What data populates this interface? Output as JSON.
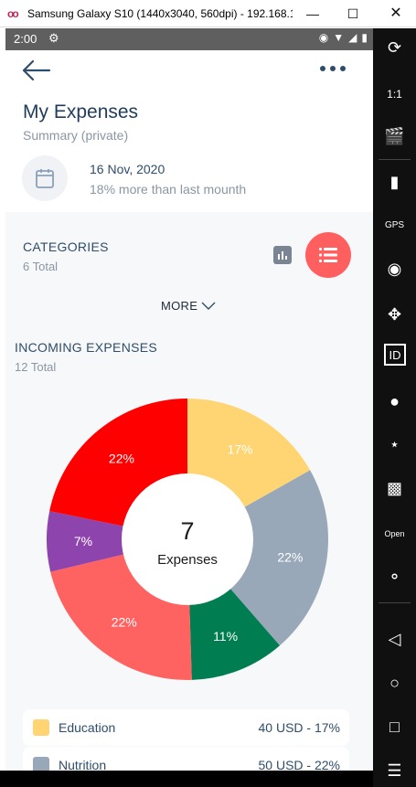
{
  "window": {
    "title": "Samsung Galaxy S10 (1440x3040, 560dpi) - 192.168.1...",
    "logo": "oo"
  },
  "status_bar": {
    "time": "2:00"
  },
  "header": {
    "title": "My Expenses",
    "subtitle": "Summary (private)",
    "date": "16 Nov, 2020",
    "comparison": "18% more than last mounth"
  },
  "categories": {
    "title": "CATEGORIES",
    "total": "6 Total",
    "more_label": "MORE"
  },
  "incoming": {
    "title": "INCOMING EXPENSES",
    "total": "12 Total"
  },
  "chart_data": {
    "type": "pie",
    "center_value": "7",
    "center_label": "Expenses",
    "slices": [
      {
        "label": "17%",
        "value": 17,
        "color": "#ffd574"
      },
      {
        "label": "22%",
        "value": 22,
        "color": "#98a8b8"
      },
      {
        "label": "11%",
        "value": 11,
        "color": "#007d51"
      },
      {
        "label": "22%",
        "value": 22,
        "color": "#ff6361"
      },
      {
        "label": "7%",
        "value": 7,
        "color": "#8e44ad"
      },
      {
        "label": "22%",
        "value": 22,
        "color": "#ff0000"
      }
    ]
  },
  "legend": [
    {
      "name": "Education",
      "value": "40 USD - 17%",
      "color": "#ffd574"
    },
    {
      "name": "Nutrition",
      "value": "50 USD - 22%",
      "color": "#98a8b8"
    }
  ],
  "icons": {
    "back": "arrow-left-icon",
    "more": "more-dots-icon",
    "calendar": "calendar-icon",
    "bar_chart": "bar-chart-icon",
    "list": "list-icon",
    "chevron": "chevron-down-icon"
  }
}
